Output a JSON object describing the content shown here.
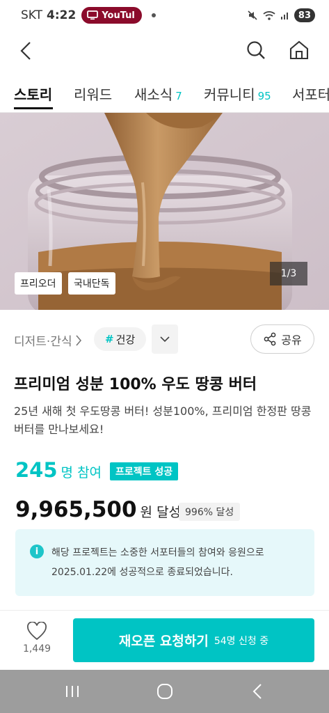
{
  "status_bar": {
    "carrier": "SKT",
    "time": "4:22",
    "notification_app": "YouTube",
    "notification_label": "YouTul",
    "battery": "83"
  },
  "tabs": [
    {
      "label": "스토리",
      "count": ""
    },
    {
      "label": "리워드",
      "count": ""
    },
    {
      "label": "새소식",
      "count": "7"
    },
    {
      "label": "커뮤니티",
      "count": "95"
    },
    {
      "label": "서포터",
      "count": ""
    }
  ],
  "hero": {
    "chips": [
      "프리오더",
      "국내단독"
    ],
    "pager": "1/3"
  },
  "category": {
    "breadcrumb": "디저트·간식",
    "hash": "#",
    "tag": "건강",
    "share_label": "공유"
  },
  "project": {
    "title": "프리미엄 성분 100% 우도 땅콩 버터",
    "subtitle": "25년 새해 첫 우도땅콩 버터! 성분100%, 프리미엄 한정판 땅콩버터를 만나보세요!",
    "participants": "245",
    "participants_unit": "명 참여",
    "status_badge": "프로젝트 성공",
    "amount": "9,965,500",
    "amount_unit": "원 달성",
    "rate": "996% 달성"
  },
  "info": {
    "icon_text": "i",
    "message": "해당 프로젝트는 소중한 서포터들의 참여와 응원으로 2025.01.22에 성공적으로 종료되었습니다."
  },
  "bottom": {
    "like_count": "1,449",
    "reopen_label": "재오픈 요청하기",
    "reopen_sub": "54명 신청 중"
  },
  "colors": {
    "accent": "#00c4c4",
    "youtube_pill": "#8b0b2b",
    "info_bg": "#e6f8fa"
  }
}
